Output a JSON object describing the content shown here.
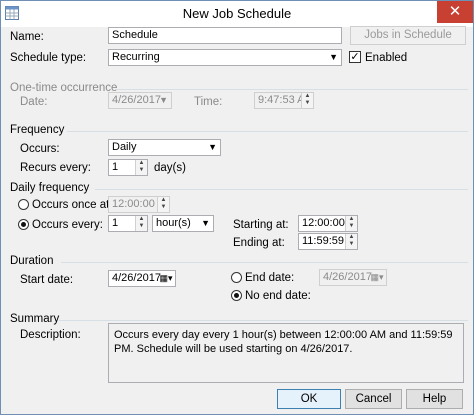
{
  "window": {
    "title": "New Job Schedule",
    "close_glyph": "✕",
    "icon": "calendar-grid-icon"
  },
  "name": {
    "label": "Name:",
    "value": "Schedule"
  },
  "jobs_button": "Jobs in Schedule",
  "schedule_type": {
    "label": "Schedule type:",
    "value": "Recurring",
    "enabled_label": "Enabled",
    "enabled": true
  },
  "one_time": {
    "header": "One-time occurrence",
    "date_label": "Date:",
    "date_value": "4/26/2017",
    "time_label": "Time:",
    "time_value": "9:47:53 AM"
  },
  "frequency": {
    "header": "Frequency",
    "occurs_label": "Occurs:",
    "occurs_value": "Daily",
    "recurs_label": "Recurs every:",
    "recurs_value": "1",
    "recurs_unit": "day(s)"
  },
  "daily_frequency": {
    "header": "Daily frequency",
    "once_label": "Occurs once at:",
    "once_value": "12:00:00 AM",
    "every_label": "Occurs every:",
    "every_value": "1",
    "every_unit": "hour(s)",
    "starting_label": "Starting at:",
    "starting_value": "12:00:00 AM",
    "ending_label": "Ending at:",
    "ending_value": "11:59:59 PM"
  },
  "duration": {
    "header": "Duration",
    "start_label": "Start date:",
    "start_value": "4/26/2017",
    "end_label": "End date:",
    "end_value": "4/26/2017",
    "no_end_label": "No end date:"
  },
  "summary": {
    "header": "Summary",
    "description_label": "Description:",
    "description": "Occurs every day every 1 hour(s) between 12:00:00 AM and 11:59:59 PM. Schedule will be used starting on 4/26/2017."
  },
  "buttons": {
    "ok": "OK",
    "cancel": "Cancel",
    "help": "Help"
  }
}
